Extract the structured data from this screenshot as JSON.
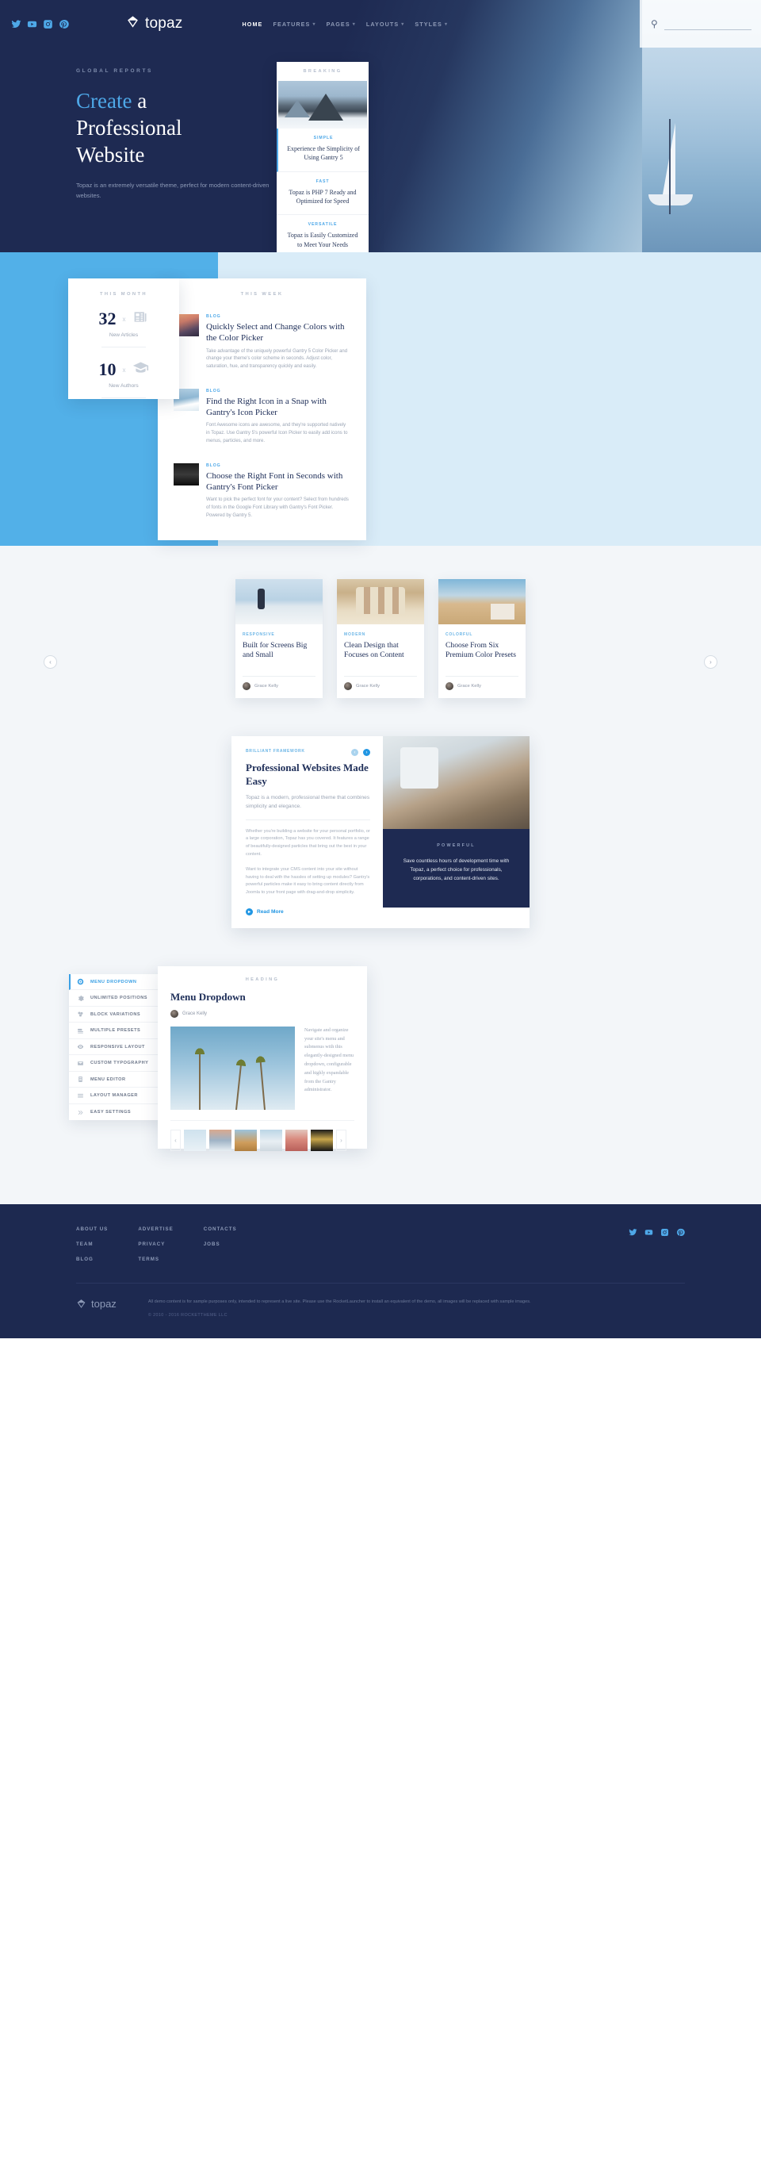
{
  "header": {
    "brand": "topaz",
    "social": [
      {
        "name": "twitter-icon",
        "label": "Twitter"
      },
      {
        "name": "youtube-icon",
        "label": "YouTube"
      },
      {
        "name": "instagram-icon",
        "label": "Instagram"
      },
      {
        "name": "pinterest-icon",
        "label": "Pinterest"
      }
    ],
    "nav": [
      {
        "label": "HOME",
        "caret": "",
        "active": true
      },
      {
        "label": "FEATURES",
        "caret": "▾",
        "active": false
      },
      {
        "label": "PAGES",
        "caret": "▾",
        "active": false
      },
      {
        "label": "LAYOUTS",
        "caret": "▾",
        "active": false
      },
      {
        "label": "STYLES",
        "caret": "▾",
        "active": false
      }
    ],
    "search": {
      "placeholder": "",
      "value": "",
      "icon": "search-icon"
    }
  },
  "hero": {
    "eyebrow": "GLOBAL REPORTS",
    "title_line1_highlight": "Create",
    "title_line1_rest": " a",
    "title_line2": "Professional",
    "title_line3": "Website",
    "subtitle": "Topaz is an extremely versatile theme, perfect for modern content-driven websites."
  },
  "breaking": {
    "heading": "BREAKING",
    "items": [
      {
        "tag": "SIMPLE",
        "title": "Experience the Simplicity of Using Gantry 5"
      },
      {
        "tag": "FAST",
        "title": "Topaz is PHP 7 Ready and Optimized for Speed"
      },
      {
        "tag": "VERSATILE",
        "title": "Topaz is Easily Customized to Meet Your Needs"
      }
    ]
  },
  "stats": {
    "heading": "THIS MONTH",
    "rows": [
      {
        "number": "32",
        "times": "x",
        "label": "New Articles",
        "icon": "newspaper-icon"
      },
      {
        "number": "10",
        "times": "x",
        "label": "New Authors",
        "icon": "graduation-cap-icon"
      }
    ]
  },
  "week": {
    "heading": "THIS WEEK",
    "posts": [
      {
        "tag": "BLOG",
        "title": "Quickly Select and Change Colors with the Color Picker",
        "desc": "Take advantage of the uniquely powerful Gantry 5 Color Picker and change your theme's color scheme in seconds. Adjust color, saturation, hue, and transparency quickly and easily."
      },
      {
        "tag": "BLOG",
        "title": "Find the Right Icon in a Snap with Gantry's Icon Picker",
        "desc": "Font Awesome icons are awesome, and they're supported natively in Topaz. Use Gantry 5's powerful Icon Picker to easily add icons to menus, particles, and more."
      },
      {
        "tag": "BLOG",
        "title": "Choose the Right Font in Seconds with Gantry's Font Picker",
        "desc": "Want to pick the perfect font for your content? Select from hundreds of fonts in the Google Font Library with Gantry's Font Picker. Powered by Gantry 5."
      }
    ]
  },
  "carousel": {
    "prev_label": "‹",
    "next_label": "›",
    "cards": [
      {
        "tag": "RESPONSIVE",
        "title": "Built for Screens Big and Small",
        "author": "Grace Kelly"
      },
      {
        "tag": "MODERN",
        "title": "Clean Design that Focuses on Content",
        "author": "Grace Kelly"
      },
      {
        "tag": "COLORFUL",
        "title": "Choose From Six Premium Color Presets",
        "author": "Grace Kelly"
      }
    ]
  },
  "feature": {
    "tag": "BRILLIANT FRAMEWORK",
    "title": "Professional Websites Made Easy",
    "lead": "Topaz is a modern, professional theme that combines simplicity and elegance.",
    "paragraph1": "Whether you're building a website for your personal portfolio, or a large corporation, Topaz has you covered. It features a range of beautifully-designed particles that bring out the best in your content.",
    "paragraph2": "Want to integrate your CMS content into your site without having to deal with the hassles of setting up modules? Gantry's powerful particles make it easy to bring content directly from Joomla to your front page with drag-and-drop simplicity.",
    "read_more": "Read More",
    "prev_label": "‹",
    "next_label": "›",
    "panel_tag": "POWERFUL",
    "panel_text": "Save countless hours of development time with Topaz, a perfect choice for professionals, corporations, and content-driven sites."
  },
  "showcase": {
    "menu": [
      {
        "label": "MENU DROPDOWN",
        "icon": "compass-icon",
        "active": true
      },
      {
        "label": "UNLIMITED POSITIONS",
        "icon": "gear-icon",
        "active": false
      },
      {
        "label": "BLOCK VARIATIONS",
        "icon": "blocks-icon",
        "active": false
      },
      {
        "label": "MULTIPLE PRESETS",
        "icon": "stack-icon",
        "active": false
      },
      {
        "label": "RESPONSIVE LAYOUT",
        "icon": "eye-icon",
        "active": false
      },
      {
        "label": "CUSTOM TYPOGRAPHY",
        "icon": "envelope-icon",
        "active": false
      },
      {
        "label": "MENU EDITOR",
        "icon": "document-icon",
        "active": false
      },
      {
        "label": "LAYOUT MANAGER",
        "icon": "lines-icon",
        "active": false
      },
      {
        "label": "EASY SETTINGS",
        "icon": "chevrons-icon",
        "active": false
      }
    ],
    "panel": {
      "heading": "HEADING",
      "title": "Menu Dropdown",
      "author": "Grace Kelly",
      "text": "Navigate and organize your site's menu and submenus with this elegantly-designed menu dropdown, configurable and highly expandable from the Gantry administrator.",
      "prev_label": "‹",
      "next_label": "›"
    }
  },
  "footer": {
    "columns": [
      [
        "ABOUT US",
        "TEAM",
        "BLOG"
      ],
      [
        "ADVERTISE",
        "PRIVACY",
        "TERMS"
      ],
      [
        "CONTACTS",
        "JOBS"
      ]
    ],
    "social": [
      {
        "name": "twitter-icon",
        "label": "Twitter"
      },
      {
        "name": "youtube-icon",
        "label": "YouTube"
      },
      {
        "name": "instagram-icon",
        "label": "Instagram"
      },
      {
        "name": "pinterest-icon",
        "label": "Pinterest"
      }
    ],
    "brand": "topaz",
    "legal": "All demo content is for sample purposes only, intended to represent a live site. Please use the RocketLauncher to install an equivalent of the demo, all images will be replaced with sample images.",
    "copyright": "© 2010 - 2016 ROCKETTHEME LLC"
  }
}
